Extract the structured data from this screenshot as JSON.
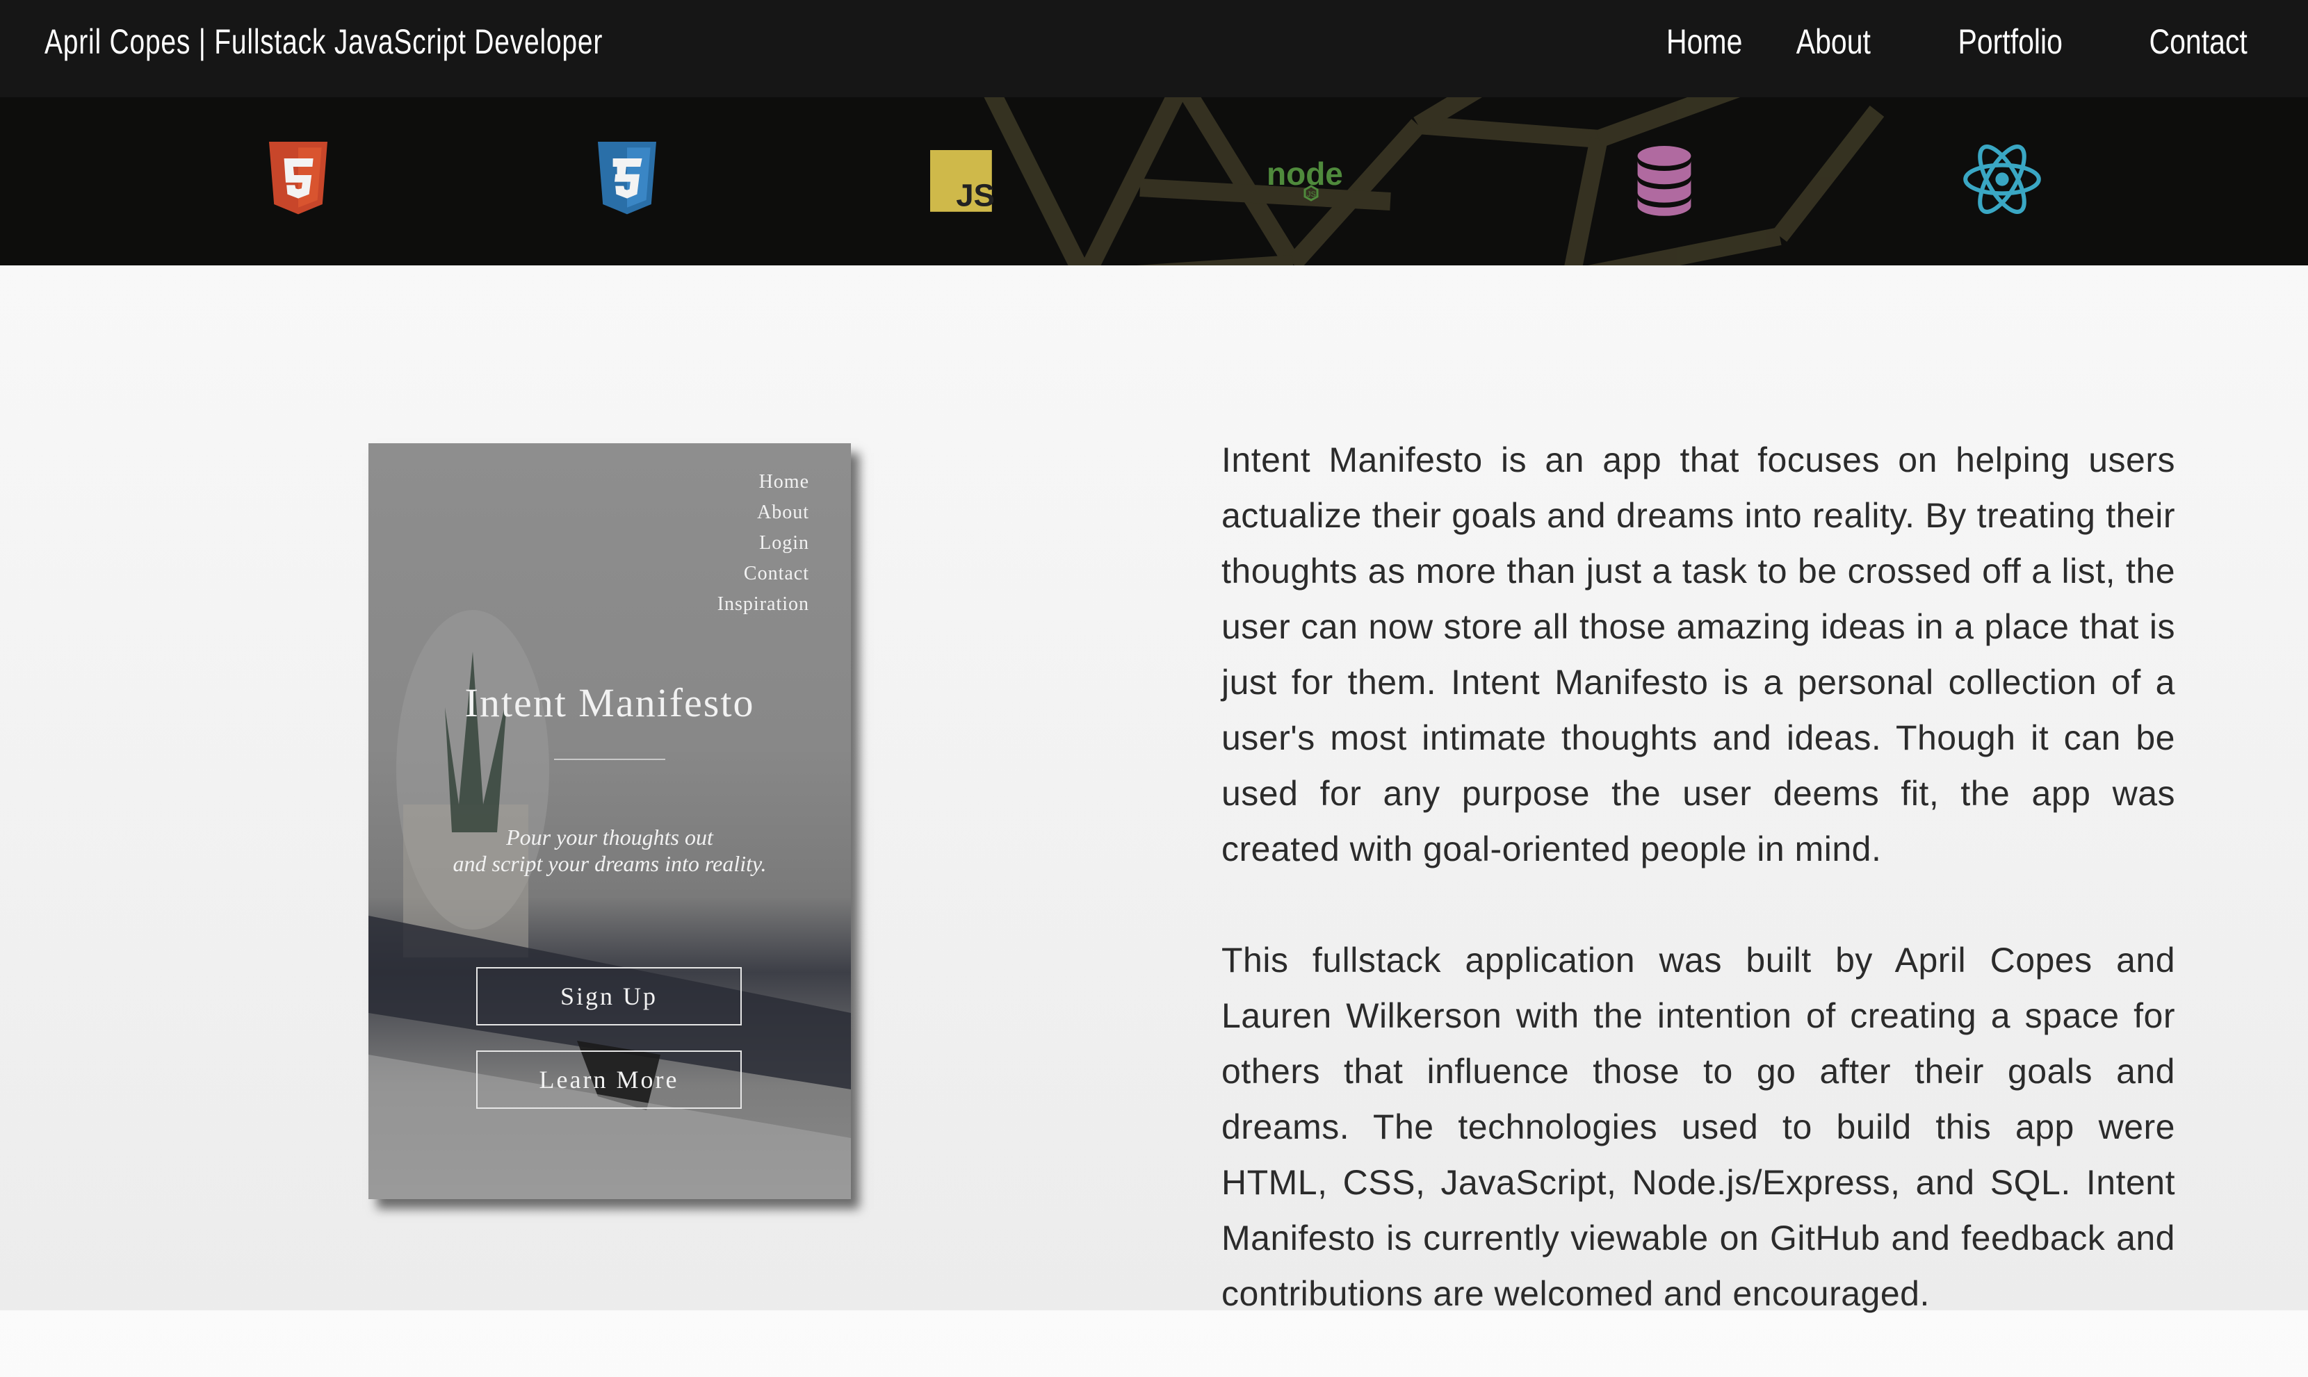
{
  "header": {
    "site_title": "April Copes | Fullstack JavaScript Developer",
    "nav": [
      "Home",
      "About",
      "Portfolio",
      "Contact"
    ]
  },
  "tech_icons": [
    {
      "name": "html5-icon",
      "color": "#e44d26"
    },
    {
      "name": "css3-icon",
      "color": "#2f7cbf"
    },
    {
      "name": "javascript-icon",
      "color": "#f0db4f",
      "text": "JS"
    },
    {
      "name": "nodejs-icon",
      "color": "#5a9d46",
      "text": "node"
    },
    {
      "name": "database-icon",
      "color": "#b772a6"
    },
    {
      "name": "react-icon",
      "color": "#3fb6d6"
    }
  ],
  "mockup": {
    "menu": [
      "Home",
      "About",
      "Login",
      "Contact",
      "Inspiration"
    ],
    "title": "Intent Manifesto",
    "tagline_line1": "Pour your thoughts out",
    "tagline_line2": "and script your dreams into reality.",
    "signup_label": "Sign Up",
    "learnmore_label": "Learn More"
  },
  "description": {
    "paragraph1": "Intent Manifesto is an app that focuses on helping users actualize their goals and dreams into reality. By treating their thoughts as more than just a task to be crossed off a list, the user can now store all those amazing ideas in a place that is just for them. Intent Manifesto is a personal collection of a user's most intimate thoughts and ideas. Though it can be used for any purpose the user deems fit, the app was created with goal-oriented people in mind.",
    "paragraph2": "This fullstack application was built by April Copes and Lauren Wilkerson with the intention of creating a space for others that influence those to go after their goals and dreams. The technologies used to build this app were HTML, CSS, JavaScript, Node.js/Express, and SQL. Intent Manifesto is currently viewable on GitHub and feedback and contributions are welcomed and encouraged."
  }
}
